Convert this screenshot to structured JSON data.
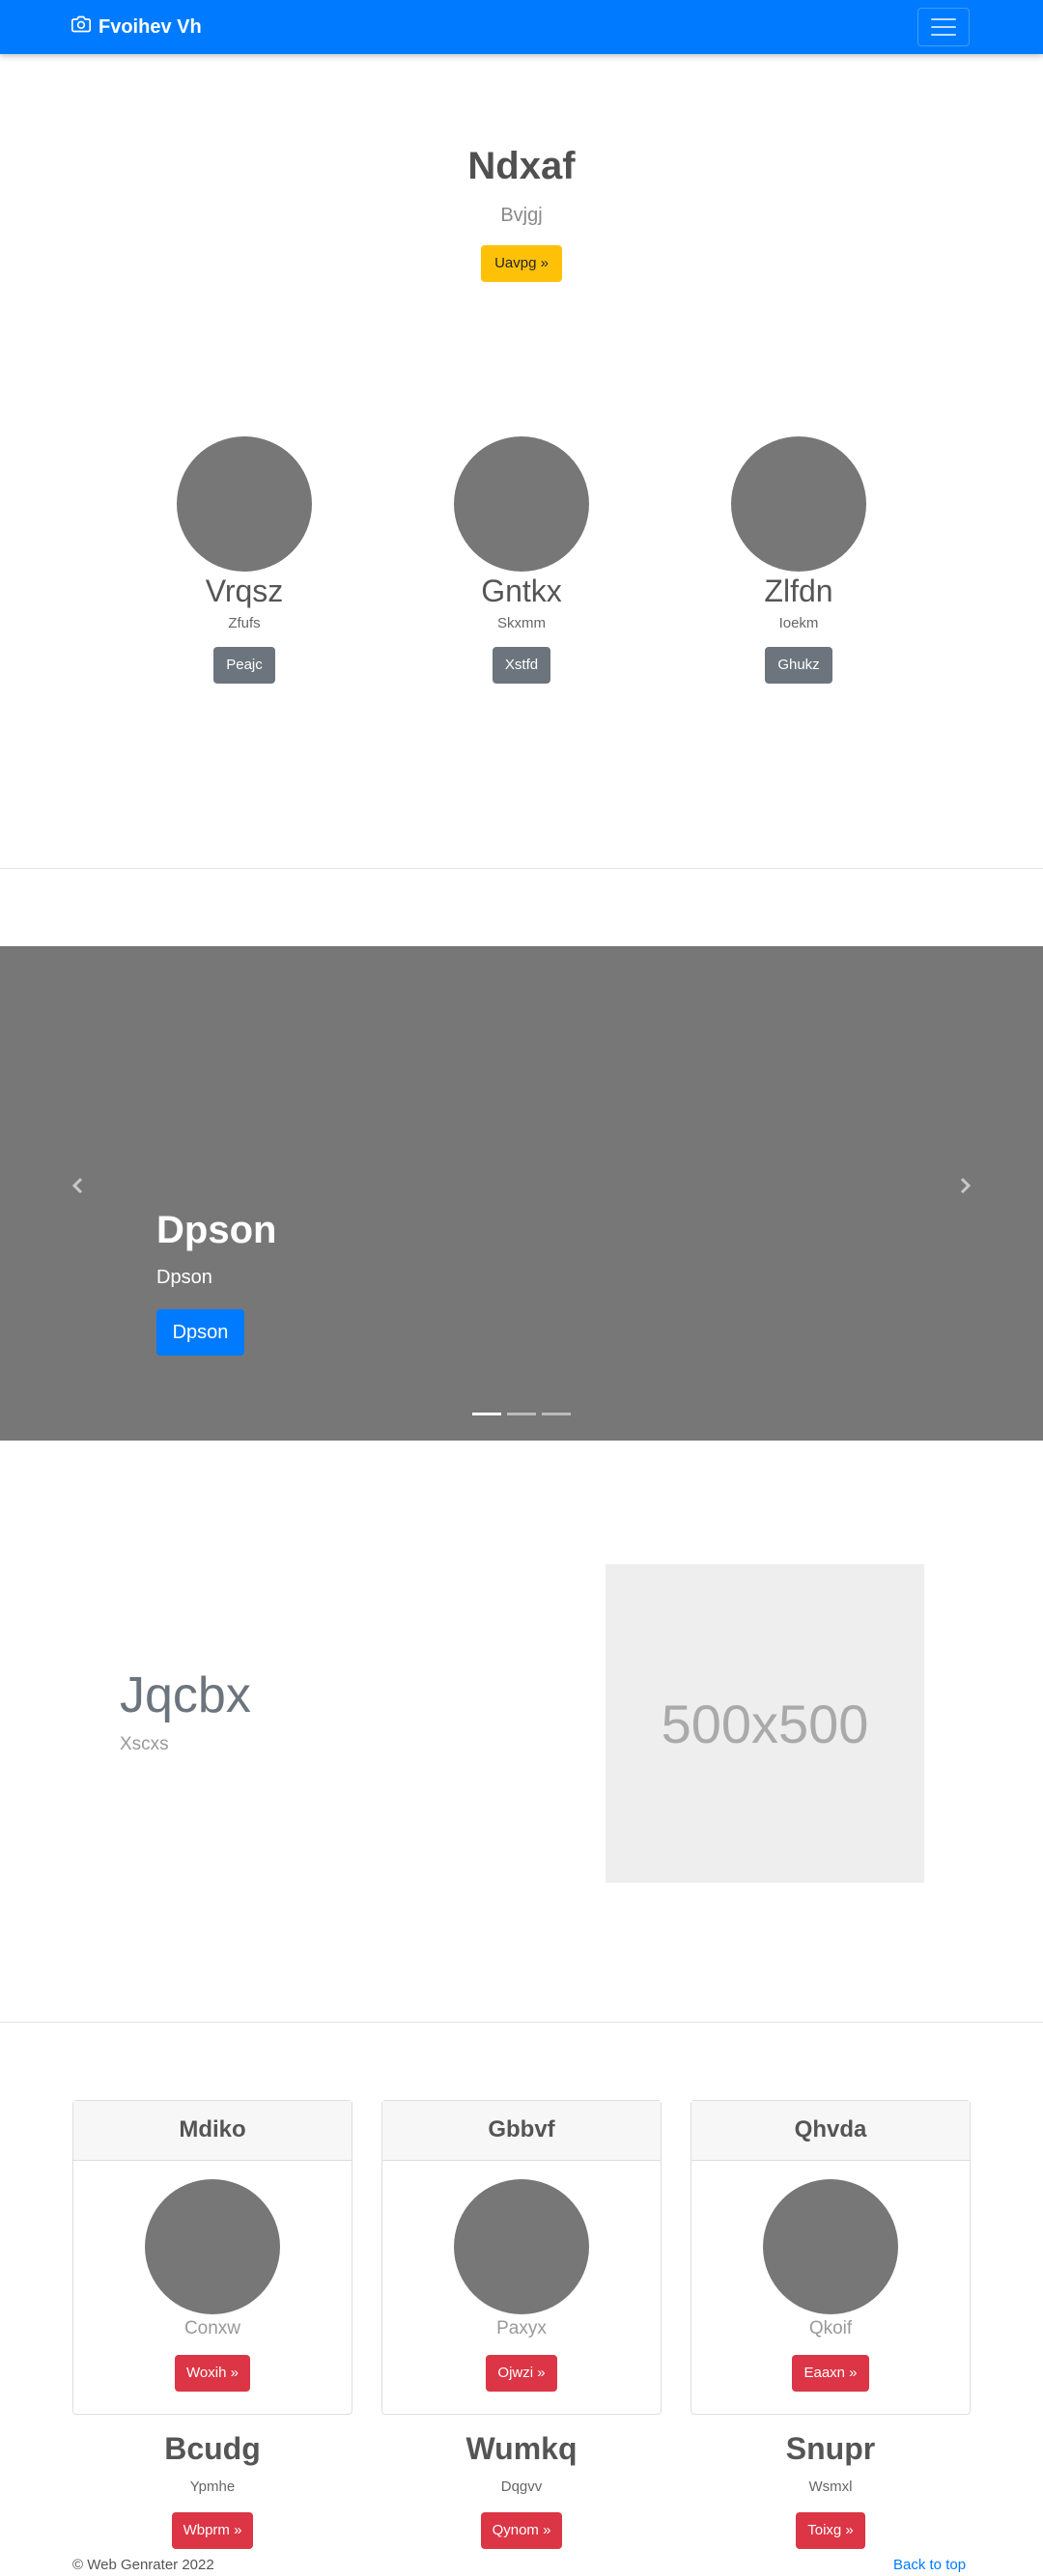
{
  "navbar": {
    "brand": "Fvoihev Vh",
    "brand_icon": "camera-icon",
    "toggler_icon": "hamburger-menu-icon",
    "color": "#007bff"
  },
  "hero": {
    "title": "Ndxaf",
    "subtitle": "Bvjgj",
    "button": "Uavpg »"
  },
  "columns": [
    {
      "title": "Vrqsz",
      "subtitle": "Zfufs",
      "button": "Peajc"
    },
    {
      "title": "Gntkx",
      "subtitle": "Skxmm",
      "button": "Xstfd"
    },
    {
      "title": "Zlfdn",
      "subtitle": "Ioekm",
      "button": "Ghukz"
    }
  ],
  "carousel": {
    "title": "Dpson",
    "text": "Dpson",
    "button": "Dpson",
    "prev_icon": "chevron-left-icon",
    "next_icon": "chevron-right-icon",
    "slide_count": 3,
    "active_slide": 1
  },
  "featurette": {
    "title": "Jqcbx",
    "subtitle": "Xscxs",
    "image_placeholder": "500x500"
  },
  "cards": [
    {
      "header": "Mdiko",
      "subtitle": "Conxw",
      "button": "Woxih »"
    },
    {
      "header": "Gbbvf",
      "subtitle": "Paxyx",
      "button": "Ojwzi »"
    },
    {
      "header": "Qhvda",
      "subtitle": "Qkoif",
      "button": "Eaaxn »"
    }
  ],
  "below_cards": [
    {
      "title": "Bcudg",
      "subtitle": "Ypmhe",
      "button": "Wbprm »"
    },
    {
      "title": "Wumkq",
      "subtitle": "Dqgvv",
      "button": "Qynom »"
    },
    {
      "title": "Snupr",
      "subtitle": "Wsmxl",
      "button": "Toixg »"
    }
  ],
  "footer": {
    "copyright": "© Web Genrater 2022",
    "back_to_top": "Back to top"
  }
}
